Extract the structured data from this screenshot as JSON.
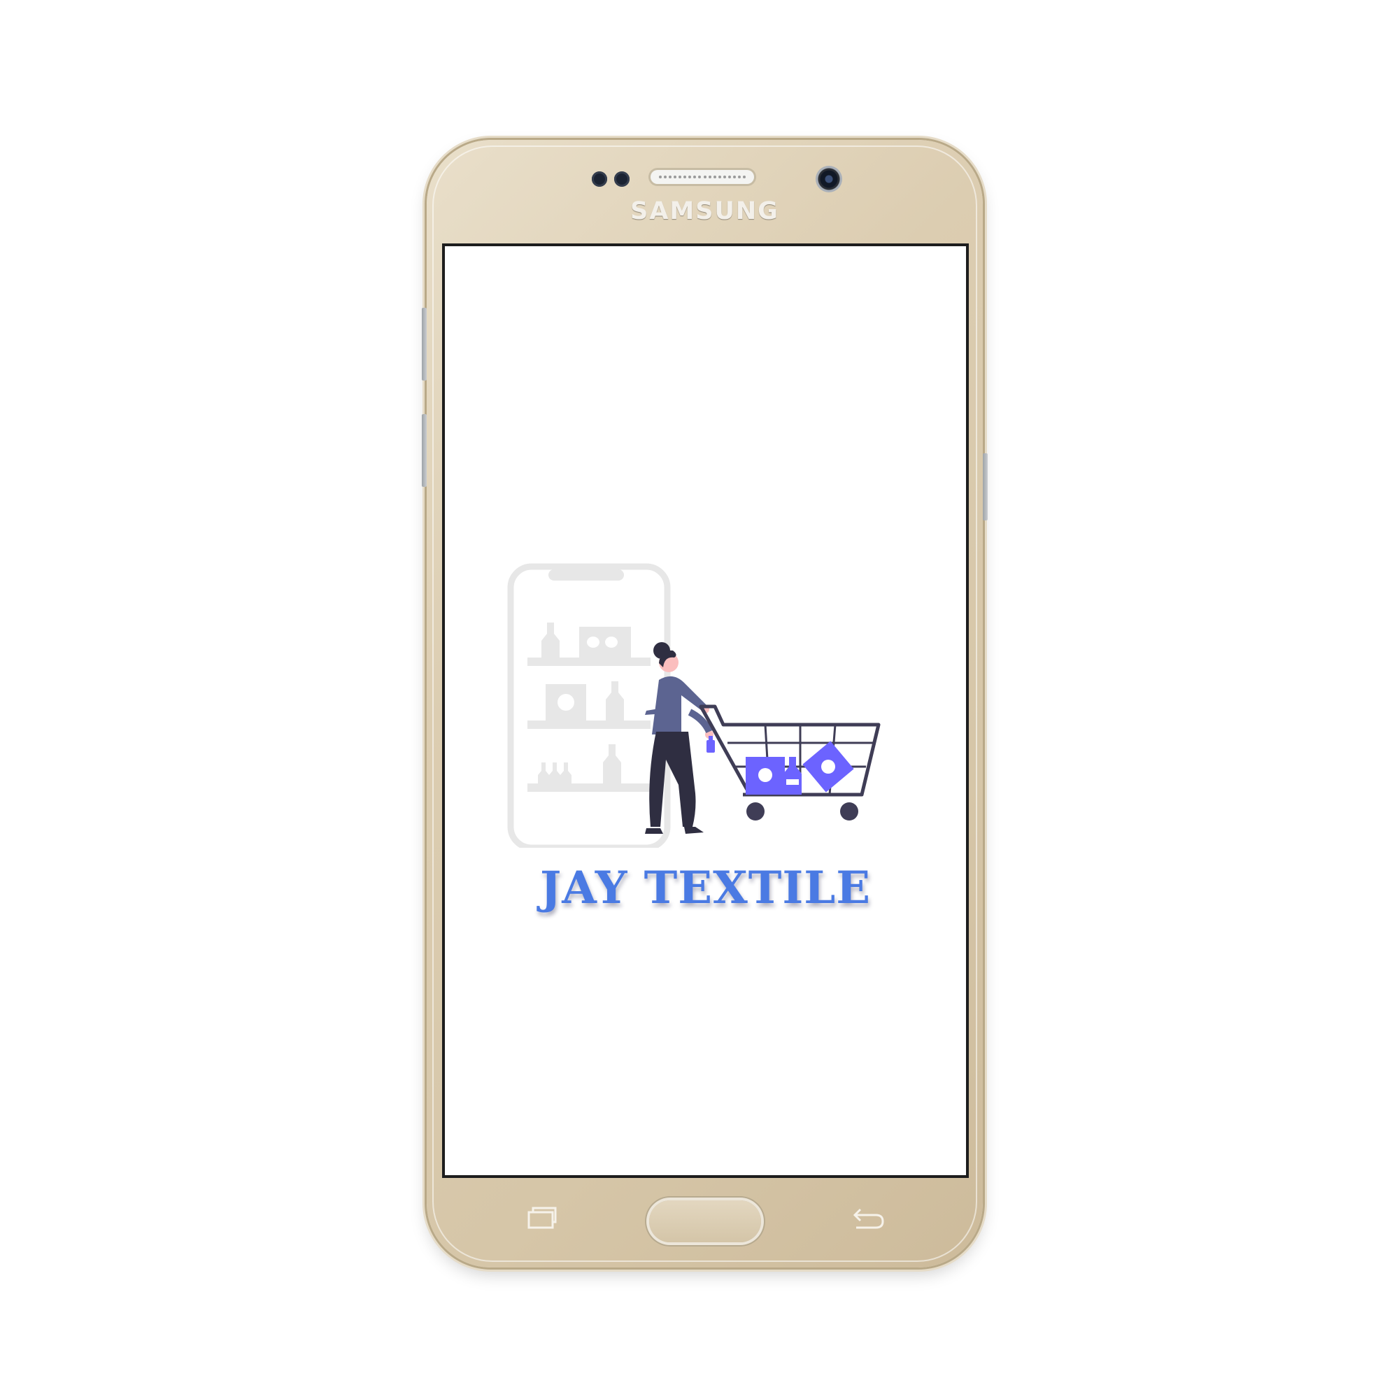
{
  "device": {
    "brand": "SAMSUNG",
    "color": "#d9cbb0",
    "nav_buttons": [
      "recents-icon",
      "home-button",
      "back-icon"
    ]
  },
  "app": {
    "logo_text": "JAY TEXTILE",
    "logo_color": "#4a7ae3",
    "illustration": "shopping-cart-woman-illustration",
    "accent_color": "#6c63ff",
    "figure_shirt_color": "#5c6491",
    "figure_pants_color": "#2f2e41"
  }
}
